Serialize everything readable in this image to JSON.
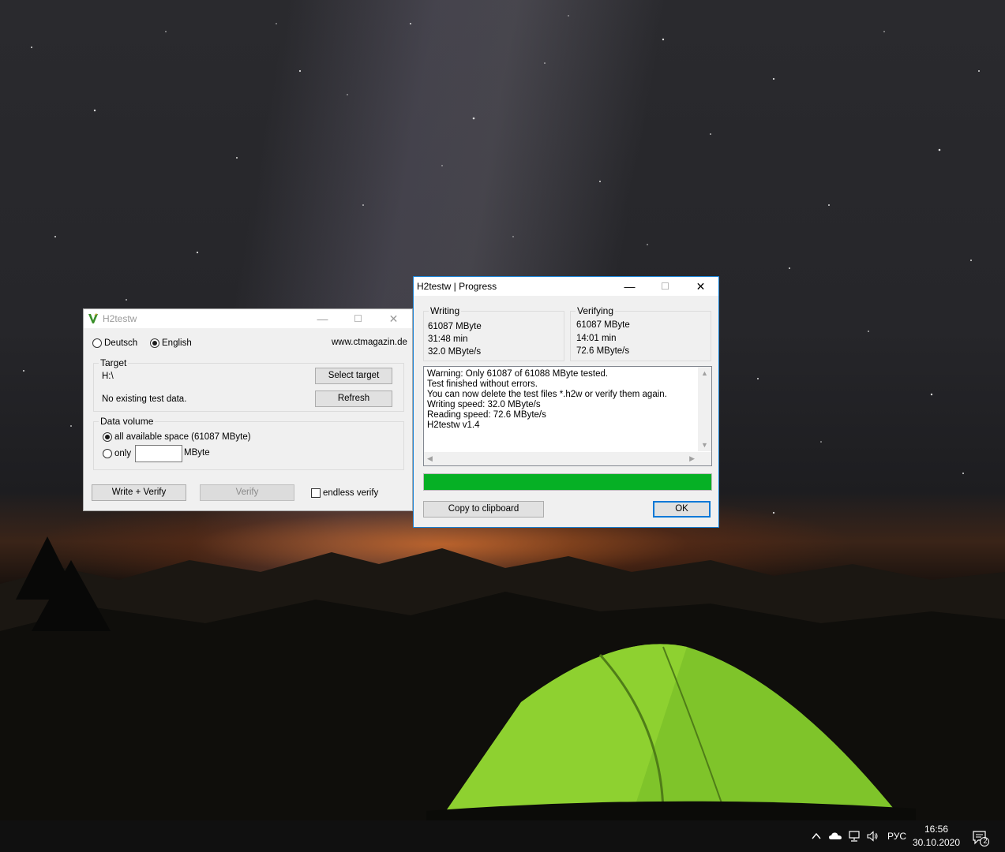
{
  "main_window": {
    "title": "H2testw",
    "language_options": [
      {
        "label": "Deutsch",
        "selected": false
      },
      {
        "label": "English",
        "selected": true
      }
    ],
    "website": "www.ctmagazin.de",
    "target": {
      "group_label": "Target",
      "path": "H:\\",
      "status": "No existing test data.",
      "select_target_label": "Select target",
      "refresh_label": "Refresh"
    },
    "data_volume": {
      "group_label": "Data volume",
      "all_space_label": "all available space (61087 MByte)",
      "all_space_selected": true,
      "only_label": "only",
      "only_value": "",
      "unit_label": "MByte"
    },
    "write_verify_label": "Write + Verify",
    "verify_label": "Verify",
    "endless_verify_label": "endless verify",
    "endless_verify_checked": false
  },
  "progress_window": {
    "title": "H2testw | Progress",
    "writing": {
      "group_label": "Writing",
      "size": "61087 MByte",
      "time": "31:48 min",
      "speed": "32.0 MByte/s"
    },
    "verifying": {
      "group_label": "Verifying",
      "size": "61087 MByte",
      "time": "14:01 min",
      "speed": "72.6 MByte/s"
    },
    "log_lines": [
      "Warning: Only 61087 of 61088 MByte tested.",
      "Test finished without errors.",
      "You can now delete the test files *.h2w or verify them again.",
      "Writing speed: 32.0 MByte/s",
      "Reading speed: 72.6 MByte/s",
      "H2testw v1.4"
    ],
    "progress_fraction": 1.0,
    "progress_color": "#06b025",
    "copy_label": "Copy to clipboard",
    "ok_label": "OK"
  },
  "taskbar": {
    "tray_icons": [
      "chevron-up-icon",
      "onedrive-cloud-icon",
      "network-icon",
      "volume-icon"
    ],
    "language": "РУС",
    "time": "16:56",
    "date": "30.10.2020",
    "notification_count": "2"
  },
  "colors": {
    "accent": "#0078d7",
    "window_bg": "#f0f0f0",
    "taskbar_bg": "#101010"
  }
}
